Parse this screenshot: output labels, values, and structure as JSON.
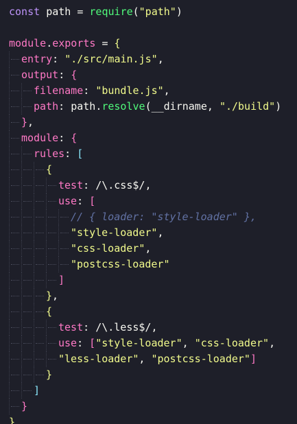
{
  "colors": {
    "background": "#1e1f29",
    "keyword": "#bd93f9",
    "variable": "#f8f8f2",
    "property": "#ff79c6",
    "string": "#f1fa8c",
    "punct": "#f8f8f2",
    "brace1": "#f1fa8c",
    "brace2": "#ff79c6",
    "brace3": "#8be9fd",
    "comment": "#6272a4",
    "func": "#50fa7b",
    "regex": "#f8f8f2"
  },
  "code": {
    "lines": [
      {
        "indent": 0,
        "tokens": [
          {
            "t": "const",
            "c": "keyword"
          },
          {
            "t": " ",
            "c": "ws"
          },
          {
            "t": "path",
            "c": "variable"
          },
          {
            "t": " = ",
            "c": "punct"
          },
          {
            "t": "require",
            "c": "func"
          },
          {
            "t": "(",
            "c": "punct"
          },
          {
            "t": "\"path\"",
            "c": "string"
          },
          {
            "t": ")",
            "c": "punct"
          }
        ]
      },
      {
        "indent": 0,
        "tokens": []
      },
      {
        "indent": 0,
        "tokens": [
          {
            "t": "module",
            "c": "property"
          },
          {
            "t": ".",
            "c": "punct"
          },
          {
            "t": "exports",
            "c": "property"
          },
          {
            "t": " = ",
            "c": "punct"
          },
          {
            "t": "{",
            "c": "brace1"
          }
        ]
      },
      {
        "indent": 1,
        "tokens": [
          {
            "t": "entry",
            "c": "property"
          },
          {
            "t": ": ",
            "c": "punct"
          },
          {
            "t": "\"./src/main.js\"",
            "c": "string"
          },
          {
            "t": ",",
            "c": "punct"
          }
        ]
      },
      {
        "indent": 1,
        "tokens": [
          {
            "t": "output",
            "c": "property"
          },
          {
            "t": ": ",
            "c": "punct"
          },
          {
            "t": "{",
            "c": "brace2"
          }
        ]
      },
      {
        "indent": 2,
        "tokens": [
          {
            "t": "filename",
            "c": "property"
          },
          {
            "t": ": ",
            "c": "punct"
          },
          {
            "t": "\"bundle.js\"",
            "c": "string"
          },
          {
            "t": ",",
            "c": "punct"
          }
        ]
      },
      {
        "indent": 2,
        "tokens": [
          {
            "t": "path",
            "c": "property"
          },
          {
            "t": ": ",
            "c": "punct"
          },
          {
            "t": "path",
            "c": "variable"
          },
          {
            "t": ".",
            "c": "punct"
          },
          {
            "t": "resolve",
            "c": "func"
          },
          {
            "t": "(",
            "c": "punct"
          },
          {
            "t": "__dirname",
            "c": "variable"
          },
          {
            "t": ", ",
            "c": "punct"
          },
          {
            "t": "\"./build\"",
            "c": "string"
          },
          {
            "t": ")",
            "c": "punct"
          }
        ]
      },
      {
        "indent": 1,
        "tokens": [
          {
            "t": "}",
            "c": "brace2"
          },
          {
            "t": ",",
            "c": "punct"
          }
        ]
      },
      {
        "indent": 1,
        "tokens": [
          {
            "t": "module",
            "c": "property"
          },
          {
            "t": ": ",
            "c": "punct"
          },
          {
            "t": "{",
            "c": "brace2"
          }
        ]
      },
      {
        "indent": 2,
        "tokens": [
          {
            "t": "rules",
            "c": "property"
          },
          {
            "t": ": ",
            "c": "punct"
          },
          {
            "t": "[",
            "c": "brace3"
          }
        ]
      },
      {
        "indent": 3,
        "tokens": [
          {
            "t": "{",
            "c": "brace1"
          }
        ]
      },
      {
        "indent": 4,
        "tokens": [
          {
            "t": "test",
            "c": "property"
          },
          {
            "t": ": ",
            "c": "punct"
          },
          {
            "t": "/\\.css$/",
            "c": "regex"
          },
          {
            "t": ",",
            "c": "punct"
          }
        ]
      },
      {
        "indent": 4,
        "tokens": [
          {
            "t": "use",
            "c": "property"
          },
          {
            "t": ": ",
            "c": "punct"
          },
          {
            "t": "[",
            "c": "brace2"
          }
        ]
      },
      {
        "indent": 5,
        "tokens": [
          {
            "t": "// { loader: \"style-loader\" },",
            "c": "comment"
          }
        ]
      },
      {
        "indent": 5,
        "tokens": [
          {
            "t": "\"style-loader\"",
            "c": "string"
          },
          {
            "t": ",",
            "c": "punct"
          }
        ]
      },
      {
        "indent": 5,
        "tokens": [
          {
            "t": "\"css-loader\"",
            "c": "string"
          },
          {
            "t": ",",
            "c": "punct"
          }
        ]
      },
      {
        "indent": 5,
        "tokens": [
          {
            "t": "\"postcss-loader\"",
            "c": "string"
          }
        ]
      },
      {
        "indent": 4,
        "tokens": [
          {
            "t": "]",
            "c": "brace2"
          }
        ]
      },
      {
        "indent": 3,
        "tokens": [
          {
            "t": "}",
            "c": "brace1"
          },
          {
            "t": ",",
            "c": "punct"
          }
        ]
      },
      {
        "indent": 3,
        "tokens": [
          {
            "t": "{",
            "c": "brace1"
          }
        ]
      },
      {
        "indent": 4,
        "tokens": [
          {
            "t": "test",
            "c": "property"
          },
          {
            "t": ": ",
            "c": "punct"
          },
          {
            "t": "/\\.less$/",
            "c": "regex"
          },
          {
            "t": ",",
            "c": "punct"
          }
        ]
      },
      {
        "indent": 4,
        "tokens": [
          {
            "t": "use",
            "c": "property"
          },
          {
            "t": ": ",
            "c": "punct"
          },
          {
            "t": "[",
            "c": "brace2"
          },
          {
            "t": "\"style-loader\"",
            "c": "string"
          },
          {
            "t": ", ",
            "c": "punct"
          },
          {
            "t": "\"css-loader\"",
            "c": "string"
          },
          {
            "t": ",",
            "c": "punct"
          }
        ]
      },
      {
        "indent": 4,
        "tokens": [
          {
            "t": "\"less-loader\"",
            "c": "string"
          },
          {
            "t": ", ",
            "c": "punct"
          },
          {
            "t": "\"postcss-loader\"",
            "c": "string"
          },
          {
            "t": "]",
            "c": "brace2"
          }
        ]
      },
      {
        "indent": 3,
        "tokens": [
          {
            "t": "}",
            "c": "brace1"
          }
        ]
      },
      {
        "indent": 2,
        "tokens": [
          {
            "t": "]",
            "c": "brace3"
          }
        ]
      },
      {
        "indent": 1,
        "tokens": [
          {
            "t": "}",
            "c": "brace2"
          }
        ]
      },
      {
        "indent": 0,
        "tokens": [
          {
            "t": "}",
            "c": "brace1"
          }
        ]
      }
    ]
  }
}
